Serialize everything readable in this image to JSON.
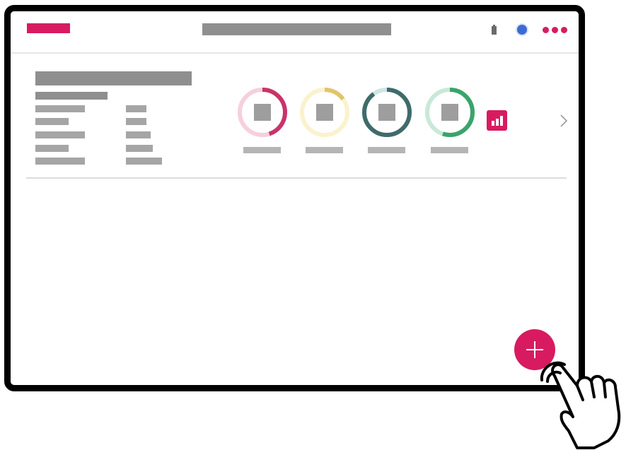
{
  "colors": {
    "accent": "#d81b60",
    "placeholder": "#a5a5a5",
    "status_dot": "#3d6bd6",
    "frame": "#000000"
  },
  "header": {
    "icons": [
      "brand-bar",
      "title-placeholder",
      "battery-icon",
      "status-dot-icon",
      "more-icon"
    ]
  },
  "gauges": [
    {
      "name": "gauge-1",
      "track_color": "#f6d0dc",
      "arc_color": "#c8346a",
      "fill": 0.45
    },
    {
      "name": "gauge-2",
      "track_color": "#fbf2cd",
      "arc_color": "#e2c46a",
      "fill": 0.15
    },
    {
      "name": "gauge-3",
      "track_color": "#cfe5e5",
      "arc_color": "#3f6b6b",
      "fill": 0.9
    },
    {
      "name": "gauge-4",
      "track_color": "#c9e9d7",
      "arc_color": "#3aa46a",
      "fill": 0.55
    }
  ],
  "actions": {
    "chart_icon": "bar-chart-icon",
    "next_icon": "chevron-right-icon",
    "fab_icon": "plus-icon"
  }
}
